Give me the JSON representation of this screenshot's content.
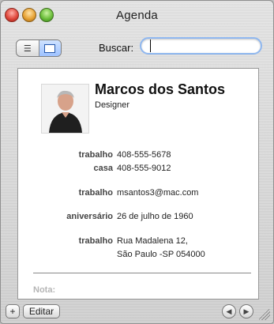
{
  "window": {
    "title": "Agenda"
  },
  "toolbar": {
    "view_list_icon": "list-view-icon",
    "view_card_icon": "card-view-icon",
    "search_label": "Buscar:",
    "search_value": ""
  },
  "contact": {
    "name": "Marcos dos Santos",
    "job_title": "Designer",
    "phones": [
      {
        "label": "trabalho",
        "value": "408-555-5678"
      },
      {
        "label": "casa",
        "value": "408-555-9012"
      }
    ],
    "email": {
      "label": "trabalho",
      "value": "msantos3@mac.com"
    },
    "birthday": {
      "label": "aniversário",
      "value": "26 de julho de 1960"
    },
    "address": {
      "label": "trabalho",
      "line1": "Rua Madalena 12,",
      "line2": "São Paulo -SP 054000"
    },
    "note_label": "Nota:"
  },
  "bottombar": {
    "add_label": "+",
    "edit_label": "Editar",
    "prev_icon": "back-arrow-icon",
    "next_icon": "forward-arrow-icon"
  }
}
